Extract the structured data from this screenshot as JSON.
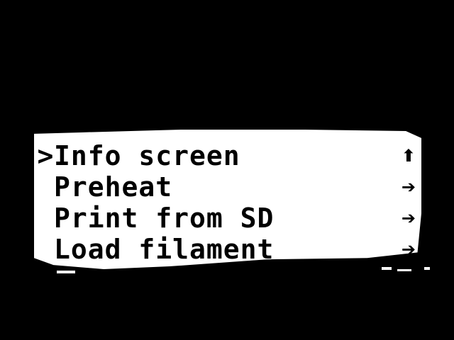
{
  "display": {
    "background": "#000000",
    "panel_color": "#ffffff",
    "text_color": "#000000"
  },
  "menu": {
    "cursor": ">",
    "selected_index": 0,
    "items": [
      {
        "label": "Info screen",
        "indicator": "scroll-up-icon",
        "indicator_glyph": "⬆"
      },
      {
        "label": "Preheat",
        "indicator": "submenu-arrow-icon",
        "indicator_glyph": "➔"
      },
      {
        "label": "Print from SD",
        "indicator": "submenu-arrow-icon",
        "indicator_glyph": "➔"
      },
      {
        "label": "Load filament",
        "indicator": "submenu-arrow-icon",
        "indicator_glyph": "➔"
      }
    ]
  }
}
